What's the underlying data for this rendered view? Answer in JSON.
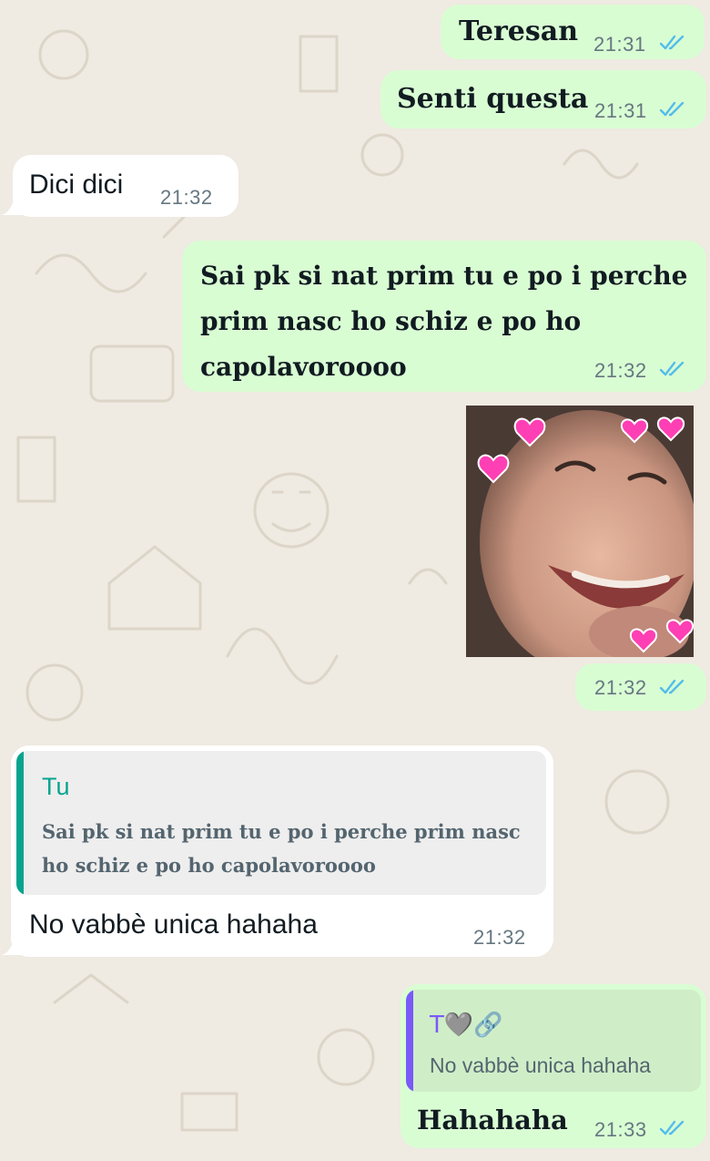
{
  "messages": [
    {
      "text": "Teresan",
      "time": "21:31"
    },
    {
      "text": "Senti questa",
      "time": "21:31"
    },
    {
      "text": "Dici dici",
      "time": "21:32"
    },
    {
      "lines": [
        "Sai pk si nat prim tu e po i perche",
        "prim nasc ho schiz e po ho",
        "capolavoroooo"
      ],
      "time": "21:32"
    },
    {
      "image_alt": "Laughing baby photo with pink heart stickers",
      "time": "21:32"
    },
    {
      "quote_author": "Tu",
      "quote_lines": [
        "Sai pk si nat prim tu e po i perche prim nasc",
        "ho schiz e po ho capolavoroooo"
      ],
      "text": "No vabbè unica hahaha",
      "time": "21:32"
    },
    {
      "quote_author": "T🩶🔗",
      "quote_text": "No vabbè unica hahaha",
      "text": "Hahahaha",
      "time": "21:33"
    }
  ],
  "colors": {
    "outgoing_bubble": "#d9fdd3",
    "incoming_bubble": "#ffffff",
    "read_ticks": "#53bdeb",
    "quote_bar_in": "#06a48e",
    "quote_bar_out": "#7a5af8"
  },
  "icons": {
    "read_receipt": "double-check-icon"
  }
}
